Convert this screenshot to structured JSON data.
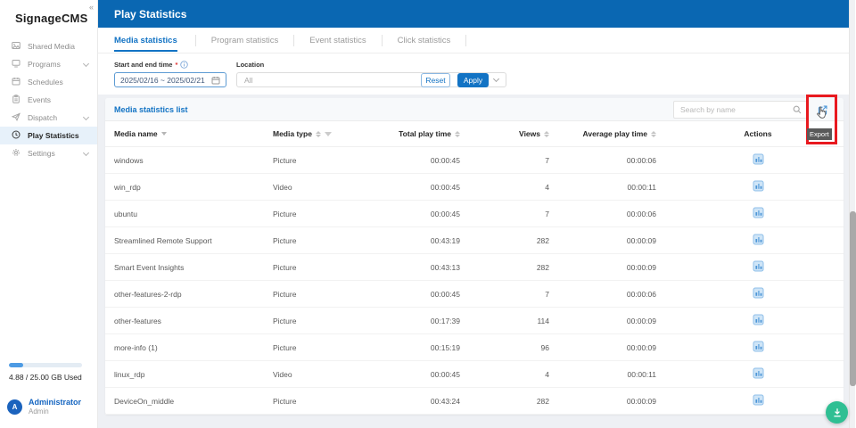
{
  "app": {
    "title": "SignageCMS"
  },
  "sidebar": {
    "items": [
      {
        "label": "Shared Media",
        "icon": "shared-media-icon",
        "submenu": false,
        "active": false
      },
      {
        "label": "Programs",
        "icon": "programs-icon",
        "submenu": true,
        "active": false
      },
      {
        "label": "Schedules",
        "icon": "schedules-icon",
        "submenu": false,
        "active": false
      },
      {
        "label": "Events",
        "icon": "events-icon",
        "submenu": false,
        "active": false
      },
      {
        "label": "Dispatch",
        "icon": "dispatch-icon",
        "submenu": true,
        "active": false
      },
      {
        "label": "Play Statistics",
        "icon": "play-statistics-icon",
        "submenu": false,
        "active": true
      },
      {
        "label": "Settings",
        "icon": "settings-icon",
        "submenu": true,
        "active": false
      }
    ],
    "storage": {
      "label": "4.88 / 25.00 GB Used",
      "percent_used": 20
    },
    "user": {
      "name": "Administrator",
      "role": "Admin",
      "avatar_letter": "A"
    }
  },
  "header": {
    "title": "Play Statistics"
  },
  "tabs": [
    {
      "label": "Media statistics",
      "active": true
    },
    {
      "label": "Program statistics",
      "active": false
    },
    {
      "label": "Event statistics",
      "active": false
    },
    {
      "label": "Click statistics",
      "active": false
    }
  ],
  "filters": {
    "date_label": "Start and end time",
    "date_required": "*",
    "date_value": "2025/02/16 ~ 2025/02/21",
    "location_label": "Location",
    "location_value": "All",
    "reset_label": "Reset",
    "apply_label": "Apply"
  },
  "list": {
    "title": "Media statistics list",
    "search_placeholder": "Search by name",
    "export_tooltip": "Export"
  },
  "table": {
    "columns": [
      {
        "label": "Media name",
        "key": "name",
        "sorter": "single",
        "filter": false,
        "align": "left"
      },
      {
        "label": "Media type",
        "key": "type",
        "sorter": "both",
        "filter": true,
        "align": "left"
      },
      {
        "label": "Total play time",
        "key": "total",
        "sorter": "both",
        "filter": false,
        "align": "right"
      },
      {
        "label": "Views",
        "key": "views",
        "sorter": "both",
        "filter": false,
        "align": "right"
      },
      {
        "label": "Average play time",
        "key": "avg",
        "sorter": "both",
        "filter": false,
        "align": "right"
      },
      {
        "label": "Actions",
        "key": "actions",
        "sorter": "",
        "filter": false,
        "align": "center"
      }
    ],
    "rows": [
      {
        "name": "windows",
        "type": "Picture",
        "total": "00:00:45",
        "views": "7",
        "avg": "00:00:06"
      },
      {
        "name": "win_rdp",
        "type": "Video",
        "total": "00:00:45",
        "views": "4",
        "avg": "00:00:11"
      },
      {
        "name": "ubuntu",
        "type": "Picture",
        "total": "00:00:45",
        "views": "7",
        "avg": "00:00:06"
      },
      {
        "name": "Streamlined Remote Support",
        "type": "Picture",
        "total": "00:43:19",
        "views": "282",
        "avg": "00:00:09"
      },
      {
        "name": "Smart Event Insights",
        "type": "Picture",
        "total": "00:43:13",
        "views": "282",
        "avg": "00:00:09"
      },
      {
        "name": "other-features-2-rdp",
        "type": "Picture",
        "total": "00:00:45",
        "views": "7",
        "avg": "00:00:06"
      },
      {
        "name": "other-features",
        "type": "Picture",
        "total": "00:17:39",
        "views": "114",
        "avg": "00:00:09"
      },
      {
        "name": "more-info (1)",
        "type": "Picture",
        "total": "00:15:19",
        "views": "96",
        "avg": "00:00:09"
      },
      {
        "name": "linux_rdp",
        "type": "Video",
        "total": "00:00:45",
        "views": "4",
        "avg": "00:00:11"
      },
      {
        "name": "DeviceOn_middle",
        "type": "Picture",
        "total": "00:43:24",
        "views": "282",
        "avg": "00:00:09"
      }
    ]
  },
  "colors": {
    "header_bg": "#0a67b2",
    "primary_blue": "#1273c4",
    "annotation_red": "#e8191f",
    "fab_green": "#2fbf93"
  }
}
